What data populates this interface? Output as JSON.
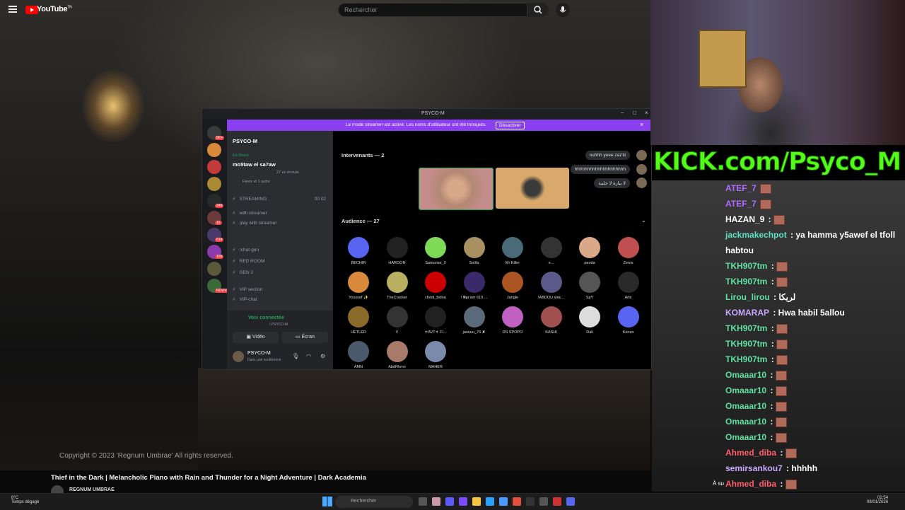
{
  "youtube": {
    "logo_text": "YouTube",
    "logo_sup": "TN",
    "search_placeholder": "Rechercher",
    "copyright": "Copyright © 2023 'Regnum Umbrae' All rights reserved.",
    "video_title": "Thief in the Dark | Melancholic Piano with Rain and Thunder for a Night Adventure | Dark Academia",
    "channel_name": "REGNUM UMBRAE"
  },
  "discord": {
    "window_title": "PSYCO-M",
    "banner_text": "Le mode streamer est activé. Les noms d'utilisateur ont été tronqués.",
    "banner_button": "Désactiver",
    "server_name": "PSYCO-M",
    "server_badges": [
      "5K+",
      "",
      "",
      "",
      "249",
      "16",
      "614",
      "109",
      "",
      "NOUVEAU"
    ],
    "server_label_lks": "L'Ks",
    "live_label": "En Direct",
    "stage_name": "mo5taw el sa7aw",
    "stage_listening": "27 en écoute",
    "stage_participants": "Fares et 1 autre",
    "channels": [
      {
        "name": "STREAMING",
        "extra": "00  02"
      },
      {
        "name": "with streamer",
        "extra": ""
      },
      {
        "name": "play with streamer",
        "extra": ""
      },
      {
        "name": "rchat-gen",
        "extra": ""
      },
      {
        "name": "RED ROOM",
        "extra": ""
      },
      {
        "name": "GEN 2",
        "extra": ""
      },
      {
        "name": "VIP section",
        "extra": ""
      },
      {
        "name": "VIP-chat",
        "extra": ""
      }
    ],
    "voice_connected": "Voix connectée",
    "voice_sub": "/ PSYCO-M",
    "video_label": "Vidéo",
    "screen_label": "Écran",
    "user_name": "PSYCO-M",
    "user_status": "Dans une conférence",
    "speakers_header": "Intervenants — 2",
    "audience_header": "Audience — 27",
    "chat": [
      "ouhhh yeee zaz'iii",
      "hhhhhhhhhhhhhhhhhhhh",
      "لا يبارة لا حلمة"
    ],
    "audience": [
      [
        "BECHIR",
        "HAROON",
        "Samurise_0",
        "Sotifa",
        "Mr Killer",
        "e...",
        "panda",
        "Zerox"
      ],
      [
        "Youssef ✨",
        "TheCracker",
        "chedi_bidou",
        "! 𝕹𝖌𝖗 ιмт 619 ...",
        "Jangle",
        "!ABDOU ʍʀє...",
        "SpY",
        "Arbi"
      ],
      [
        "HETLER",
        "V",
        "⚜AVT⚜ FI...",
        "jaouuu_76 ✘",
        "DS SPOPO",
        "KASHI",
        "Dali",
        "Kenza"
      ],
      [
        "AMN",
        "AbdRhmn",
        "MAHER"
      ]
    ]
  },
  "kick": {
    "banner": "KICK.com/Psyco_M",
    "messages": [
      {
        "user": "ATEF_7",
        "text": "",
        "color": "#b36bff"
      },
      {
        "user": "ATEF_7",
        "text": "",
        "color": "#b36bff"
      },
      {
        "user": "HAZAN_9",
        "text": ":",
        "color": "#ffffff"
      },
      {
        "user": "jackmakechpot",
        "text": ": ya hamma y5awef el tfoll habtou",
        "color": "#5fe0c0"
      },
      {
        "user": "TKH907tm",
        "text": ":",
        "color": "#5fe0a0"
      },
      {
        "user": "TKH907tm",
        "text": ":",
        "color": "#5fe0a0"
      },
      {
        "user": "Lirou_lirou",
        "text": ": لريكا",
        "color": "#5fe0a0"
      },
      {
        "user": "KOMARAP",
        "text": ": Hwa habil 5allou",
        "color": "#c9a8ff"
      },
      {
        "user": "TKH907tm",
        "text": ":",
        "color": "#5fe0a0"
      },
      {
        "user": "TKH907tm",
        "text": ":",
        "color": "#5fe0a0"
      },
      {
        "user": "TKH907tm",
        "text": ":",
        "color": "#5fe0a0"
      },
      {
        "user": "Omaaar10",
        "text": ":",
        "color": "#5fe0a0"
      },
      {
        "user": "Omaaar10",
        "text": ":",
        "color": "#5fe0a0"
      },
      {
        "user": "Omaaar10",
        "text": ":",
        "color": "#5fe0a0"
      },
      {
        "user": "Omaaar10",
        "text": ":",
        "color": "#5fe0a0"
      },
      {
        "user": "Omaaar10",
        "text": ":",
        "color": "#5fe0a0"
      },
      {
        "user": "Ahmed_diba",
        "text": ":",
        "color": "#ff5a6a"
      },
      {
        "user": "semirsankou7",
        "text": ": hhhhh",
        "color": "#c9a8ff"
      },
      {
        "user": "Ahmed_diba",
        "text": ":",
        "color": "#ff5a6a"
      },
      {
        "user": "Ahmed_diba",
        "text": ":",
        "color": "#ff5a6a"
      }
    ],
    "follow_prefix": "À su"
  },
  "taskbar": {
    "weather_temp": "8°C",
    "weather_desc": "Temps dégagé",
    "search": "Rechercher",
    "time": "02:54",
    "date": "08/01/2026"
  }
}
